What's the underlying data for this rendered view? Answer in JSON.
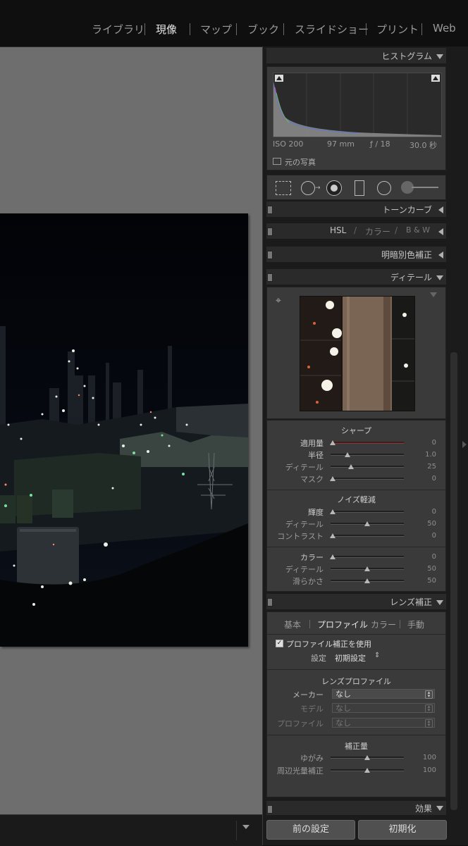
{
  "modules": [
    "ライブラリ",
    "現像",
    "マップ",
    "ブック",
    "スライドショー",
    "プリント",
    "Web"
  ],
  "histogram": {
    "title": "ヒストグラム",
    "iso": "ISO 200",
    "focal": "97 mm",
    "aperture": "ƒ / 18",
    "shutter": "30.0 秒",
    "original_photo": "元の写真"
  },
  "panels": {
    "tone_curve": "トーンカーブ",
    "hsl": "HSL",
    "hsl_sep1": "/",
    "color": "カラー",
    "hsl_sep2": "/",
    "bw": "B & W",
    "split_toning": "明暗別色補正",
    "detail": "ディテール",
    "lens": "レンズ補正",
    "effects": "効果"
  },
  "sharpen": {
    "title": "シャープ",
    "rows": [
      {
        "label": "適用量",
        "value": "0",
        "pos": 0.03
      },
      {
        "label": "半径",
        "value": "1.0",
        "pos": 0.23
      },
      {
        "label": "ディテール",
        "value": "25",
        "pos": 0.28
      },
      {
        "label": "マスク",
        "value": "0",
        "pos": 0.03
      }
    ]
  },
  "noise": {
    "title": "ノイズ軽減",
    "rows": [
      {
        "label": "輝度",
        "value": "0",
        "pos": 0.03
      },
      {
        "label": "ディテール",
        "value": "50",
        "pos": 0.5
      },
      {
        "label": "コントラスト",
        "value": "0",
        "pos": 0.03
      },
      {
        "label": "カラー",
        "value": "0",
        "pos": 0.03
      },
      {
        "label": "ディテール",
        "value": "50",
        "pos": 0.5
      },
      {
        "label": "滑らかさ",
        "value": "50",
        "pos": 0.5
      }
    ]
  },
  "lens": {
    "tabs": [
      "基本",
      "プロファイル",
      "カラー",
      "手動"
    ],
    "active_tab": "プロファイル",
    "enable_profile": "プロファイル補正を使用",
    "setup_label": "設定",
    "setup_value": "初期設定",
    "profile_section": "レンズプロファイル",
    "maker_label": "メーカー",
    "maker_value": "なし",
    "model_label": "モデル",
    "model_value": "なし",
    "profile_label": "プロファイル",
    "profile_value": "なし",
    "amount_section": "補正量",
    "distortion_label": "ゆがみ",
    "distortion_value": "100",
    "vignette_label": "周辺光量補正",
    "vignette_value": "100"
  },
  "buttons": {
    "previous": "前の設定",
    "reset": "初期化"
  }
}
